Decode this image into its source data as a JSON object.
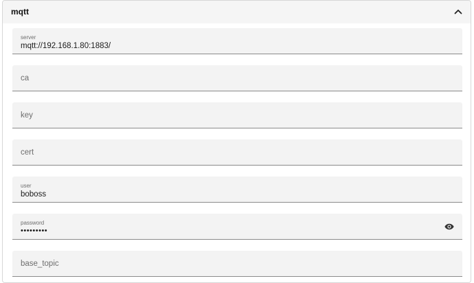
{
  "section": {
    "title": "mqtt",
    "expanded": true
  },
  "fields": {
    "server": {
      "label": "server",
      "value": "mqtt://192.168.1.80:1883/"
    },
    "ca": {
      "label": "ca",
      "value": ""
    },
    "key": {
      "label": "key",
      "value": ""
    },
    "cert": {
      "label": "cert",
      "value": ""
    },
    "user": {
      "label": "user",
      "value": "boboss"
    },
    "password": {
      "label": "password",
      "masked_value": "•••••••••"
    },
    "base_topic": {
      "label": "base_topic",
      "value": ""
    }
  },
  "icons": {
    "collapse": "chevron-up-icon",
    "reveal_password": "eye-icon"
  },
  "colors": {
    "field_background": "#f3f3f3",
    "underline": "#8a8a8a",
    "header_background": "#f5f5f5"
  }
}
